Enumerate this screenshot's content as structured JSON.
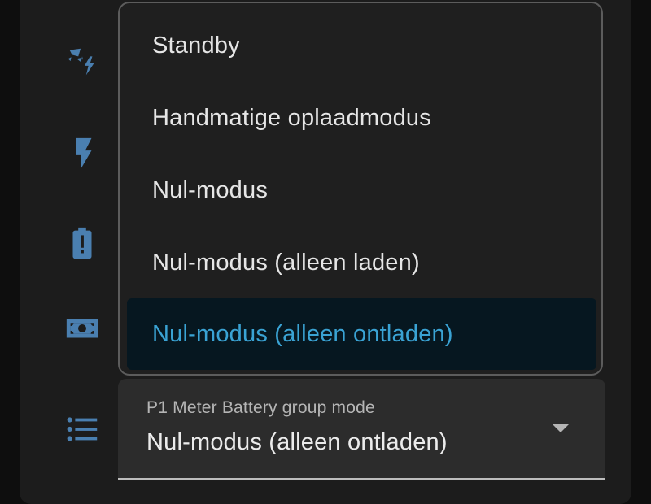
{
  "colors": {
    "background": "#0e0e0e",
    "card": "#1c1c1c",
    "menu": "#1f1f1f",
    "accent": "#3aa3d4",
    "icon": "#4a7fb0",
    "text": "#e6e6e6"
  },
  "icons": [
    "solar-power-icon",
    "flash-icon",
    "battery-alert-icon",
    "cash-icon",
    "format-list-bulleted-icon"
  ],
  "dropdown_menu": {
    "items": [
      {
        "label": "Standby"
      },
      {
        "label": "Handmatige oplaadmodus"
      },
      {
        "label": "Nul-modus"
      },
      {
        "label": "Nul-modus (alleen laden)"
      },
      {
        "label": "Nul-modus (alleen ontladen)"
      }
    ]
  },
  "select": {
    "label": "P1 Meter Battery group mode",
    "value": "Nul-modus (alleen ontladen)"
  }
}
